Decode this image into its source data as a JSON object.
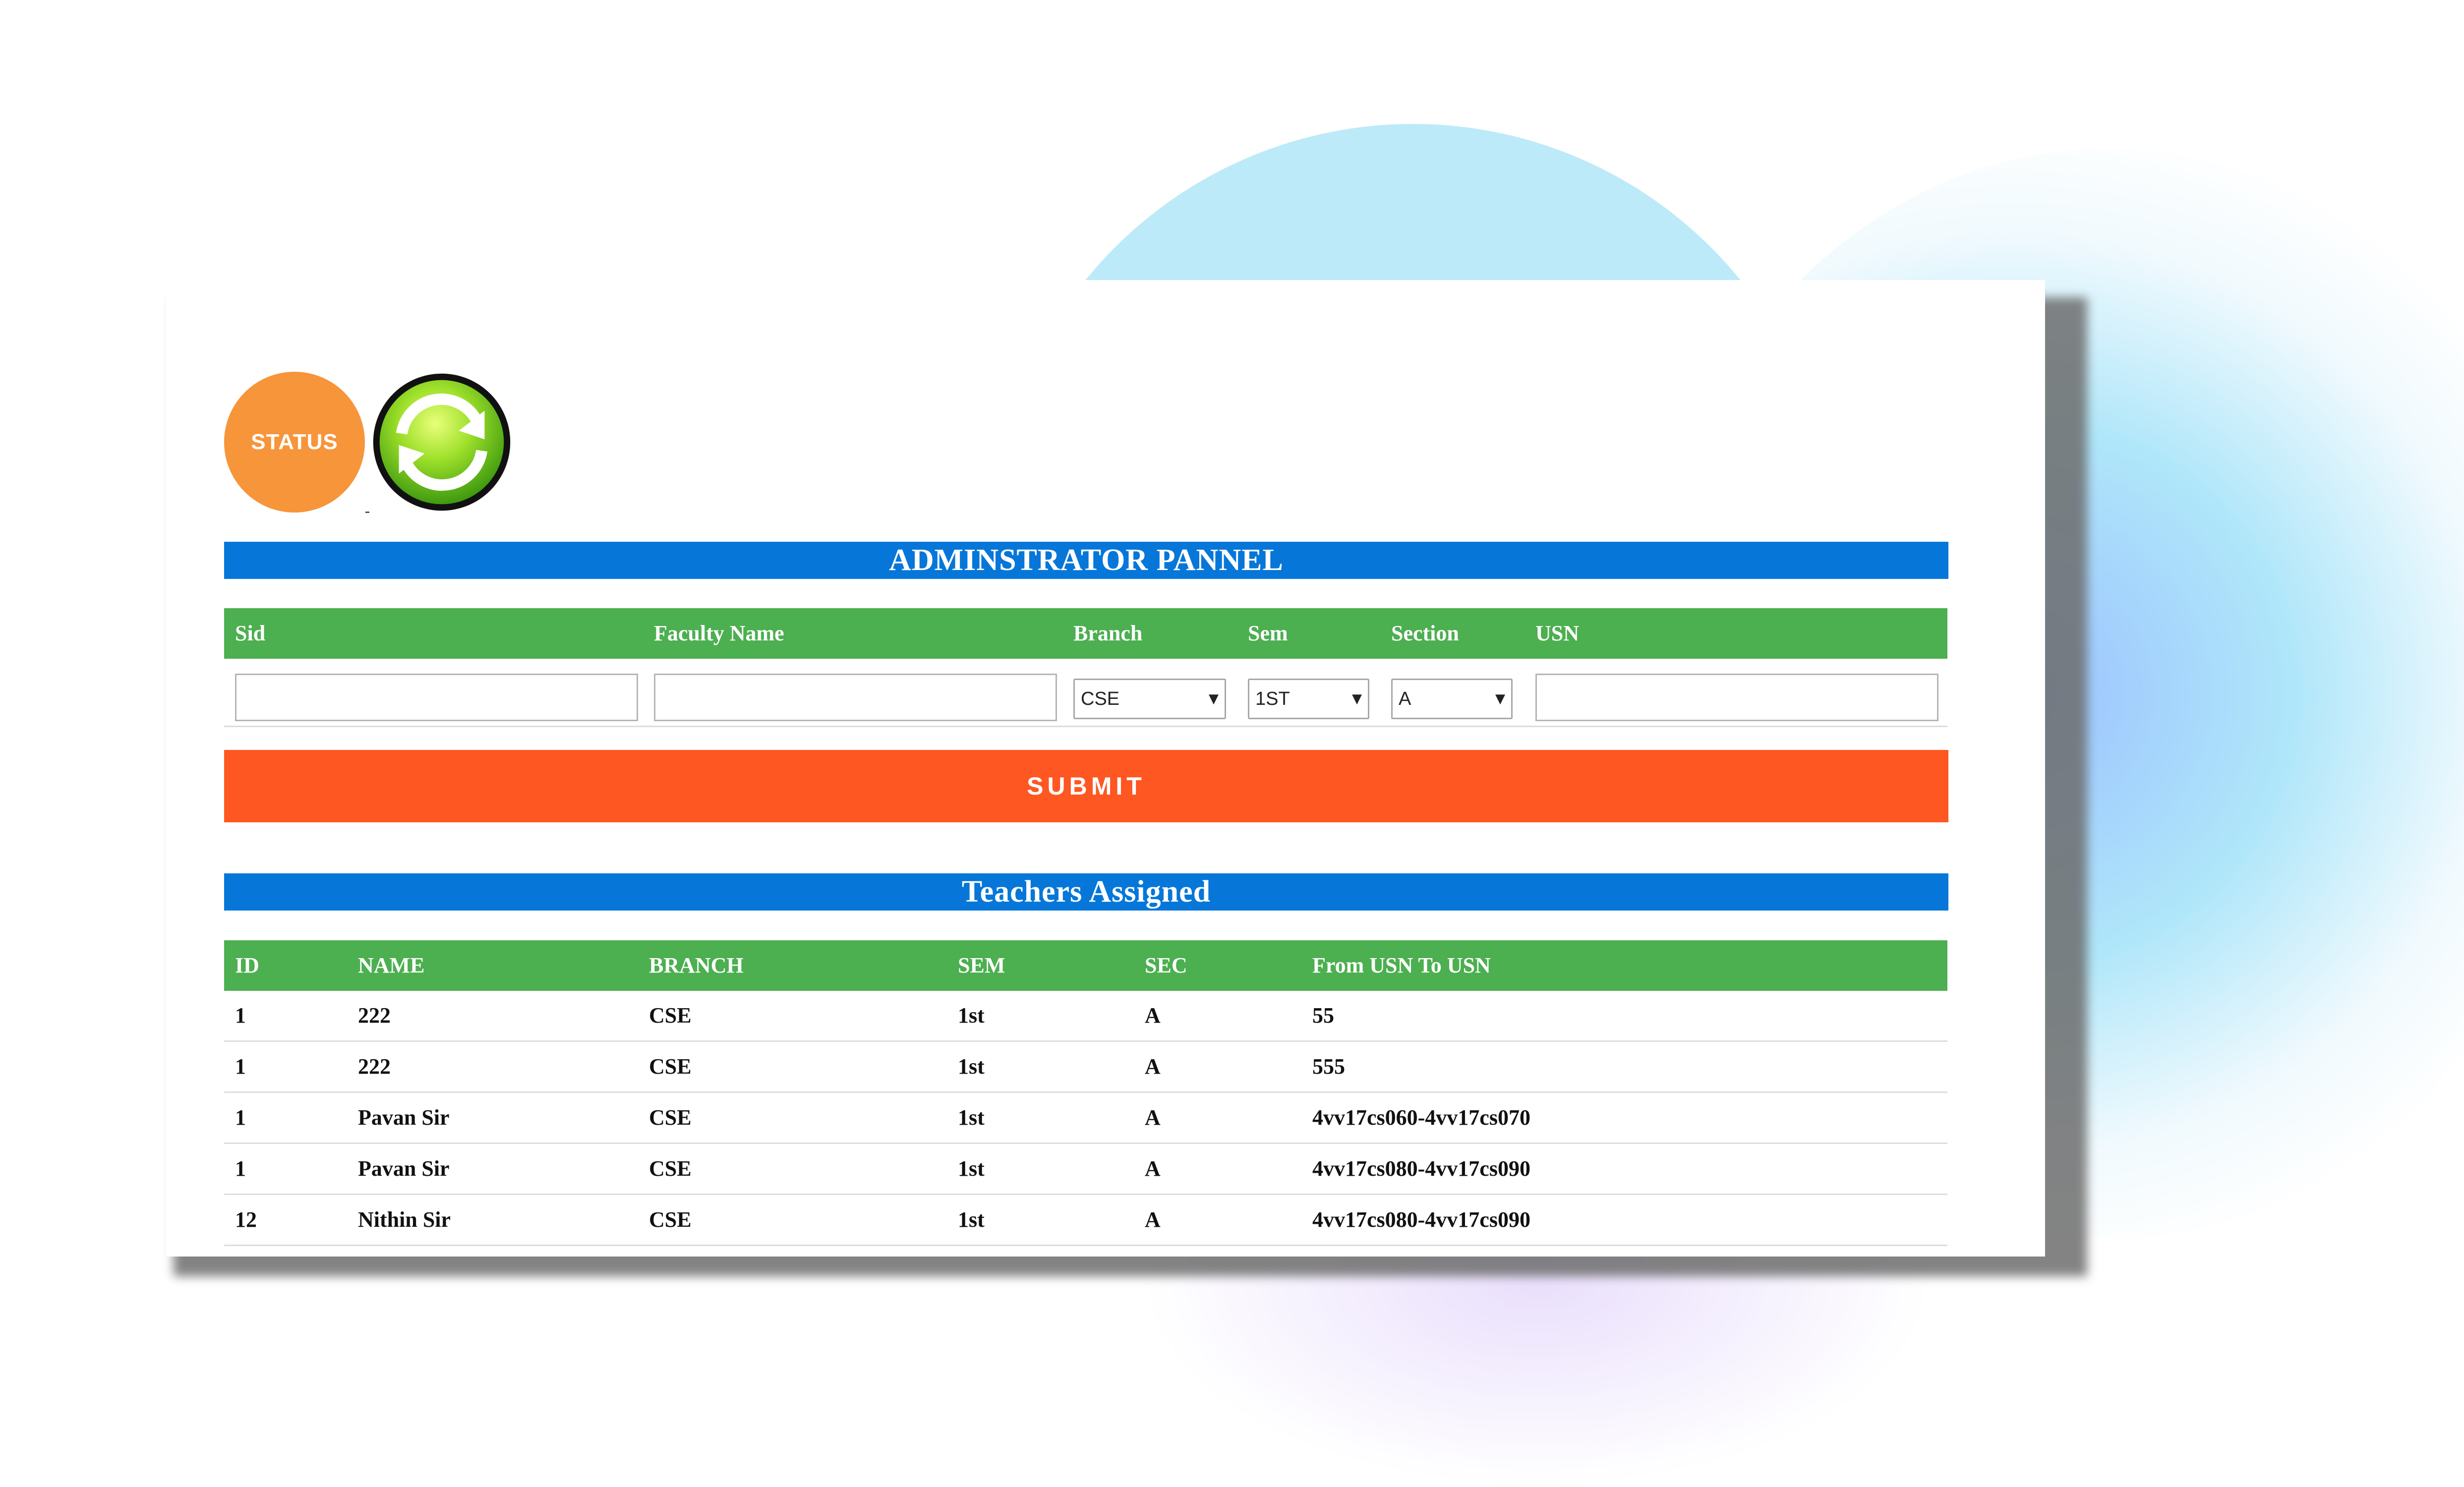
{
  "status_button": {
    "label": "STATUS"
  },
  "admin_panel": {
    "title": "ADMINSTRATOR PANNEL",
    "headers": {
      "sid": "Sid",
      "faculty_name": "Faculty Name",
      "branch": "Branch",
      "sem": "Sem",
      "section": "Section",
      "usn": "USN"
    },
    "fields": {
      "sid_value": "",
      "faculty_name_value": "",
      "branch_selected": "CSE",
      "sem_selected": "1ST",
      "section_selected": "A",
      "usn_value": ""
    },
    "submit_label": "SUBMIT"
  },
  "teachers": {
    "title": "Teachers Assigned",
    "columns": {
      "id": "ID",
      "name": "NAME",
      "branch": "BRANCH",
      "sem": "SEM",
      "sec": "SEC",
      "usn_range": "From USN To USN"
    },
    "rows": [
      {
        "id": "1",
        "name": "222",
        "branch": "CSE",
        "sem": "1st",
        "sec": "A",
        "usn_range": "55"
      },
      {
        "id": "1",
        "name": "222",
        "branch": "CSE",
        "sem": "1st",
        "sec": "A",
        "usn_range": "555"
      },
      {
        "id": "1",
        "name": "Pavan Sir",
        "branch": "CSE",
        "sem": "1st",
        "sec": "A",
        "usn_range": "4vv17cs060-4vv17cs070"
      },
      {
        "id": "1",
        "name": "Pavan Sir",
        "branch": "CSE",
        "sem": "1st",
        "sec": "A",
        "usn_range": "4vv17cs080-4vv17cs090"
      },
      {
        "id": "12",
        "name": "Nithin Sir",
        "branch": "CSE",
        "sem": "1st",
        "sec": "A",
        "usn_range": "4vv17cs080-4vv17cs090"
      }
    ]
  },
  "colors": {
    "header_blue": "#0677d8",
    "table_green": "#4caf50",
    "submit_orange": "#ff5722",
    "status_orange": "#f7953a",
    "refresh_green": "#7ed321"
  },
  "icons": {
    "refresh": "refresh-icon"
  }
}
